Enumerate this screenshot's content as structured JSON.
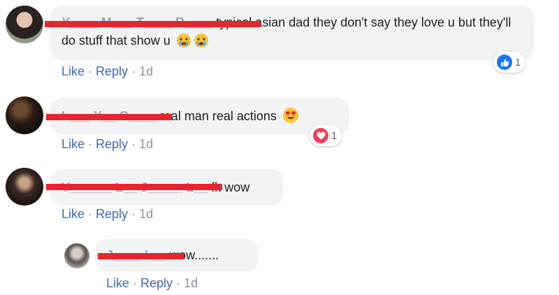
{
  "comments": [
    {
      "author": "Y____ M___ T____ B____",
      "text": "typical asian dad they don't say they love u but they'll do stuff that show u",
      "emojis": [
        "crying-face-icon",
        "crying-face-icon"
      ],
      "reaction": {
        "type": "like",
        "count": "1"
      },
      "actions": {
        "like": "Like",
        "reply": "Reply",
        "time": "1d"
      }
    },
    {
      "author": "L___ Y__ C____",
      "text": "real man real actions",
      "emojis": [
        "heart-eyes-icon"
      ],
      "reaction": {
        "type": "love",
        "count": "1"
      },
      "actions": {
        "like": "Like",
        "reply": "Reply",
        "time": "1d"
      }
    },
    {
      "author": "V______ L__ J_____ L__",
      "text": "fk wow",
      "actions": {
        "like": "Like",
        "reply": "Reply",
        "time": "1d"
      }
    },
    {
      "author": "J____ L__",
      "text": "wow.......",
      "actions": {
        "like": "Like",
        "reply": "Reply",
        "time": "1d"
      }
    }
  ],
  "colors": {
    "link": "#4267b2",
    "bubble": "#f2f3f5",
    "redaction": "#e8242c",
    "like_blue": "#1877f2",
    "love_red": "#f33e58"
  }
}
